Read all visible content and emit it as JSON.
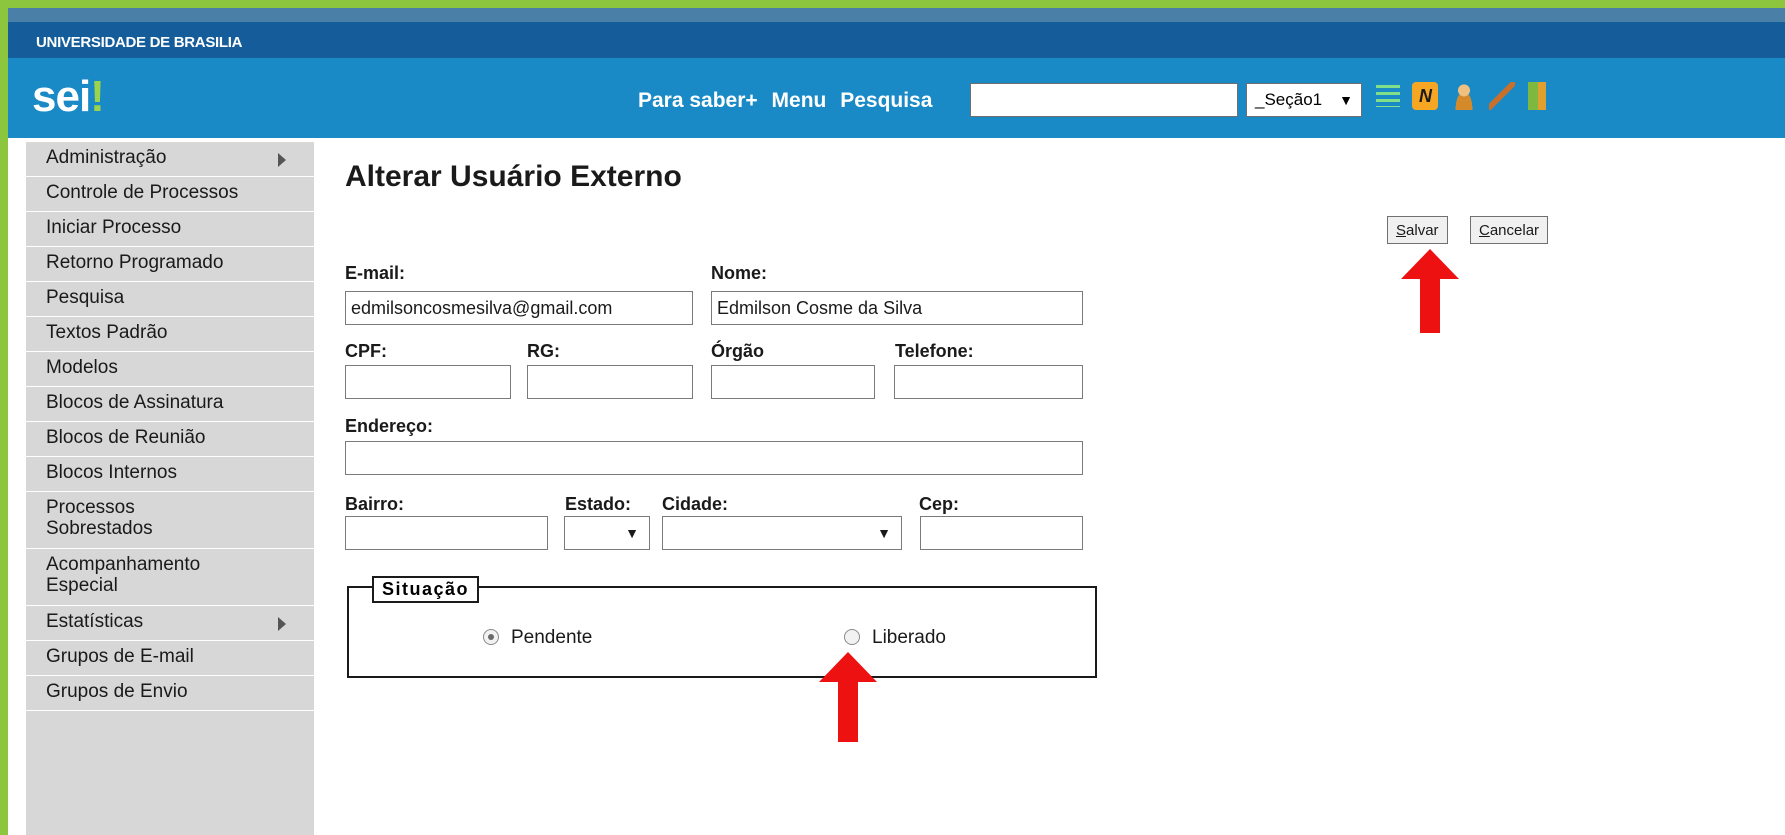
{
  "header": {
    "university": "UNIVERSIDADE DE BRASILIA",
    "logo_text": "sei",
    "logo_mark": "!",
    "nav": [
      "Para saber+",
      "Menu",
      "Pesquisa"
    ],
    "search_value": "",
    "unit_select": "_Seção1",
    "select_arrow": "▼",
    "n_icon_text": "N",
    "icons": [
      "list-icon",
      "n-icon",
      "user-icon",
      "wrench-icon",
      "exit-icon"
    ]
  },
  "sidebar": {
    "items": [
      {
        "label": "Administração",
        "submenu": true
      },
      {
        "label": "Controle de Processos",
        "submenu": false
      },
      {
        "label": "Iniciar Processo",
        "submenu": false
      },
      {
        "label": "Retorno Programado",
        "submenu": false
      },
      {
        "label": "Pesquisa",
        "submenu": false
      },
      {
        "label": "Textos Padrão",
        "submenu": false
      },
      {
        "label": "Modelos",
        "submenu": false
      },
      {
        "label": "Blocos de Assinatura",
        "submenu": false
      },
      {
        "label": "Blocos de Reunião",
        "submenu": false
      },
      {
        "label": "Blocos Internos",
        "submenu": false
      },
      {
        "label": "Processos Sobrestados",
        "submenu": false
      },
      {
        "label": "Acompanhamento Especial",
        "submenu": false
      },
      {
        "label": "Estatísticas",
        "submenu": true
      },
      {
        "label": "Grupos de E-mail",
        "submenu": false
      },
      {
        "label": "Grupos de Envio",
        "submenu": false
      }
    ]
  },
  "form": {
    "title": "Alterar Usuário Externo",
    "save_button": {
      "accesskey": "S",
      "rest": "alvar"
    },
    "cancel_button": {
      "accesskey": "C",
      "rest": "ancelar"
    },
    "labels": {
      "email": "E-mail:",
      "nome": "Nome:",
      "cpf": "CPF:",
      "rg": "RG:",
      "orgao": "Órgão",
      "telefone": "Telefone:",
      "endereco": "Endereço:",
      "bairro": "Bairro:",
      "estado": "Estado:",
      "cidade": "Cidade:",
      "cep": "Cep:"
    },
    "values": {
      "email": "edmilsoncosmesilva@gmail.com",
      "nome": "Edmilson Cosme da Silva",
      "cpf": "",
      "rg": "",
      "orgao": "",
      "telefone": "",
      "endereco": "",
      "bairro": "",
      "estado": "",
      "cidade": "",
      "cep": ""
    },
    "situacao": {
      "legend": "Situação",
      "options": [
        {
          "label": "Pendente",
          "checked": true
        },
        {
          "label": "Liberado",
          "checked": false
        }
      ]
    }
  },
  "colors": {
    "frame_border": "#8cc63f",
    "header_dark": "#155d9a",
    "header_main": "#1a8ac6",
    "sidebar_bg": "#d7d7d7",
    "annotation_arrow": "#ee1111"
  }
}
